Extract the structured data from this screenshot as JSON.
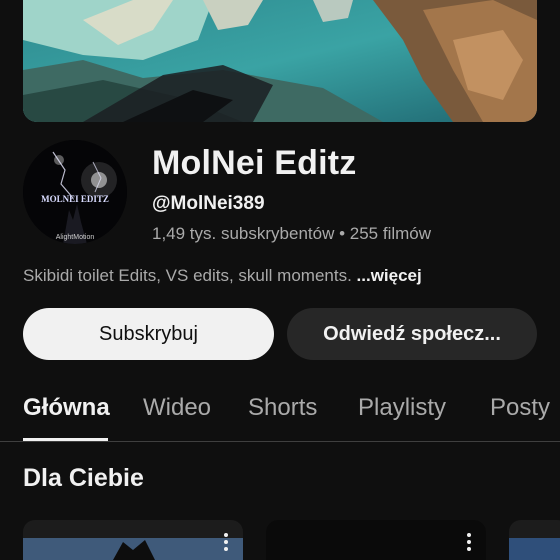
{
  "channel": {
    "name": "MolNei Editz",
    "handle": "@MolNei389",
    "stats": "1,49 tys. subskrybentów • 255 filmów",
    "description": "Skibidi toilet Edits, VS edits, skull moments.",
    "more_label": "...więcej",
    "avatar_text": "MOLNEI EDITZ",
    "avatar_watermark": "AlightMotion"
  },
  "actions": {
    "subscribe_label": "Subskrybuj",
    "community_label": "Odwiedź społecz..."
  },
  "tabs": [
    {
      "label": "Główna",
      "active": true
    },
    {
      "label": "Wideo",
      "active": false
    },
    {
      "label": "Shorts",
      "active": false
    },
    {
      "label": "Playlisty",
      "active": false
    },
    {
      "label": "Posty",
      "active": false
    }
  ],
  "section": {
    "title": "Dla Ciebie"
  },
  "icons": {
    "card_menu": "more-vert-icon"
  },
  "colors": {
    "background": "#0f0f0f",
    "text_primary": "#f1f1f1",
    "text_secondary": "#aaaaaa",
    "subscribe_bg": "#f1f1f1",
    "secondary_button_bg": "#272727"
  }
}
